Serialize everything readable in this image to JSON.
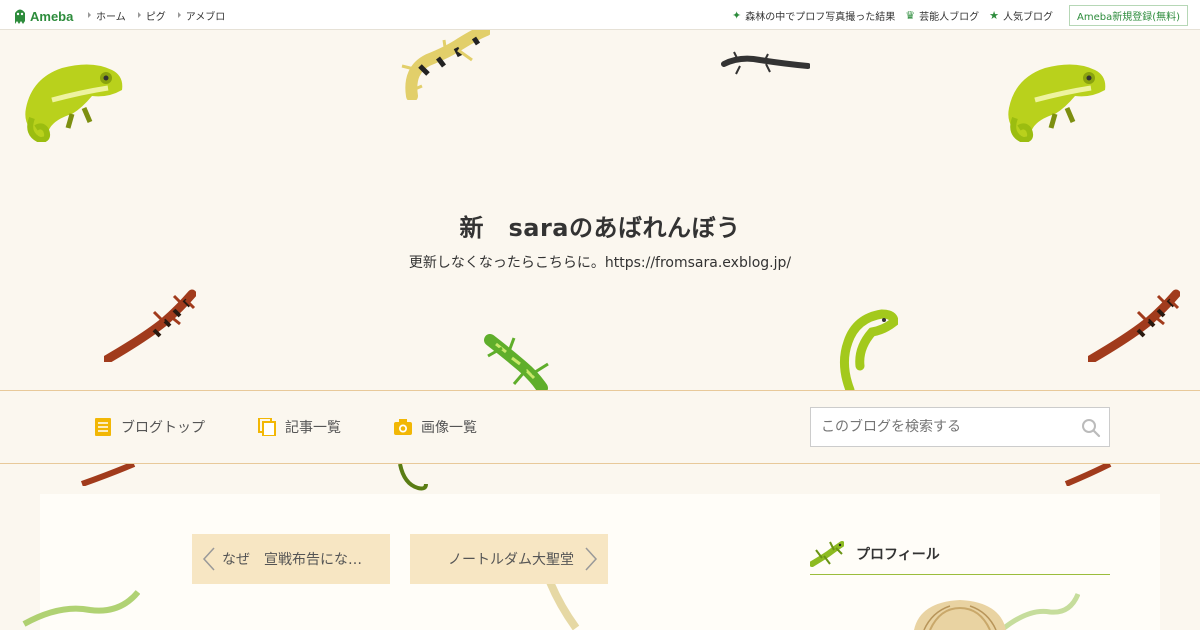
{
  "topbar": {
    "logo": "Ameba",
    "left_links": [
      "ホーム",
      "ピグ",
      "アメブロ"
    ],
    "right_links": [
      {
        "icon": "sparkle-icon",
        "label": "森林の中でプロフ写真撮った結果"
      },
      {
        "icon": "crown-icon",
        "label": "芸能人ブログ"
      },
      {
        "icon": "star-icon",
        "label": "人気ブログ"
      }
    ],
    "signup": "Ameba新規登録(無料)"
  },
  "header": {
    "title": "新　saraのあばれんぼう",
    "description": "更新しなくなったらこちらに。https://fromsara.exblog.jp/"
  },
  "nav": {
    "items": [
      {
        "icon": "document-icon",
        "label": "ブログトップ"
      },
      {
        "icon": "copy-icon",
        "label": "記事一覧"
      },
      {
        "icon": "camera-icon",
        "label": "画像一覧"
      }
    ],
    "search_placeholder": "このブログを検索する"
  },
  "pager": {
    "prev": "なぜ　宣戦布告にな…",
    "next": "ノートルダム大聖堂"
  },
  "sidebar": {
    "profile_label": "プロフィール"
  },
  "colors": {
    "brand_green": "#2d8c3c",
    "background": "#fbf7ef",
    "pager_bg": "#f7e6c3",
    "nav_icon": "#f2b705"
  }
}
